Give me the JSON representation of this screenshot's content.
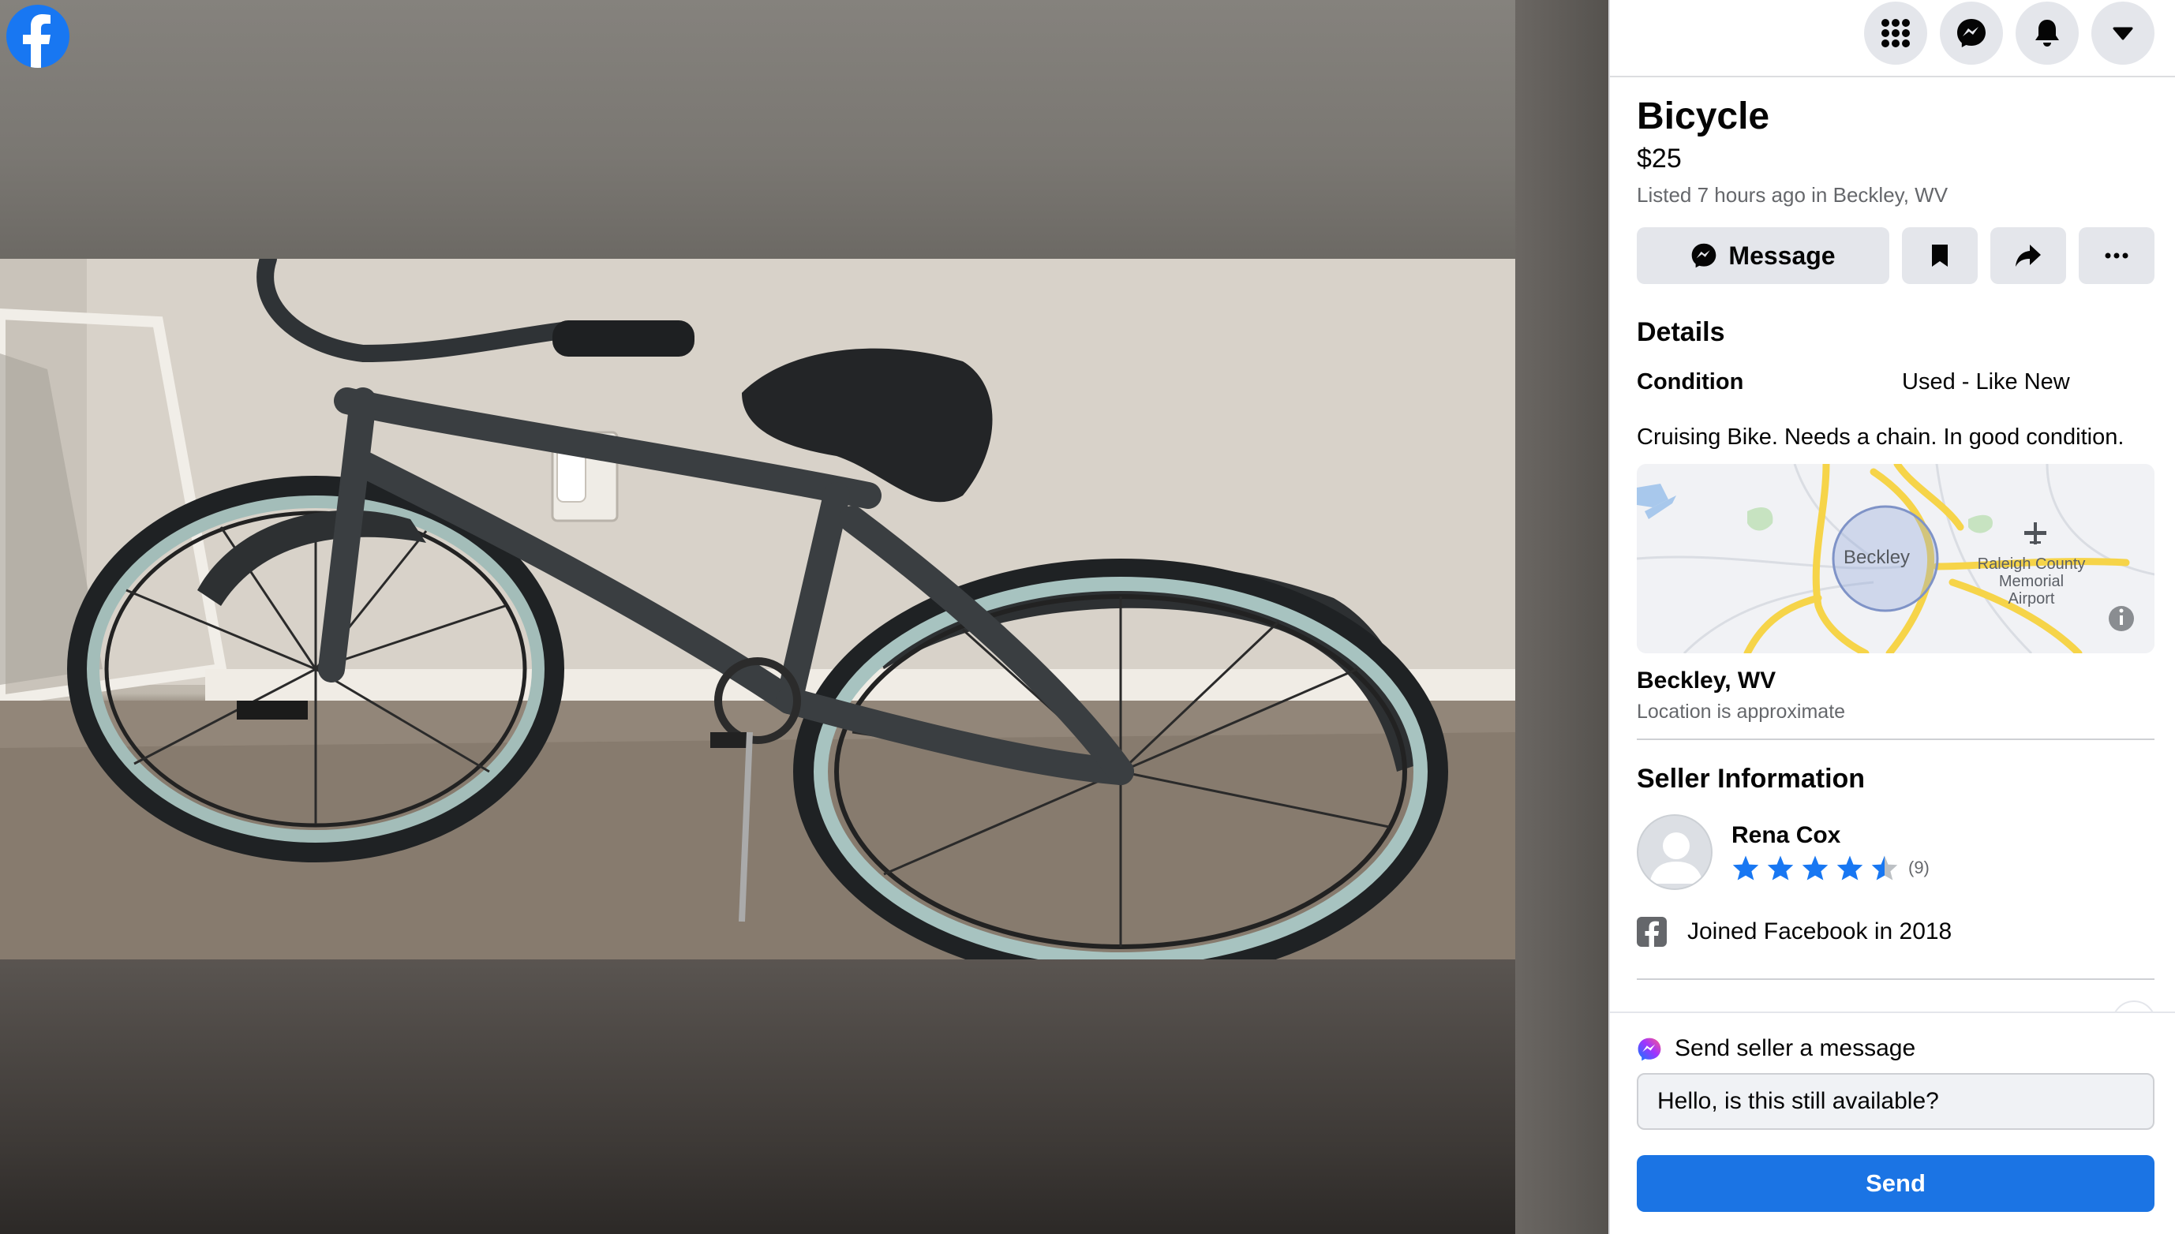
{
  "header": {
    "logo_icon": "facebook-logo-icon",
    "buttons": [
      {
        "name": "menu",
        "icon": "grid-menu-icon"
      },
      {
        "name": "messenger",
        "icon": "messenger-icon"
      },
      {
        "name": "notifications",
        "icon": "bell-icon"
      },
      {
        "name": "account",
        "icon": "caret-down-icon"
      }
    ]
  },
  "listing": {
    "title": "Bicycle",
    "price": "$25",
    "meta": "Listed 7 hours ago in Beckley, WV",
    "photo_icon": "bicycle-photo"
  },
  "actions": {
    "message_label": "Message",
    "message_icon": "messenger-icon",
    "save_icon": "bookmark-icon",
    "share_icon": "share-arrow-icon",
    "more_icon": "ellipsis-icon"
  },
  "details": {
    "heading": "Details",
    "condition_label": "Condition",
    "condition_value": "Used - Like New",
    "description": "Cruising Bike. Needs a chain. In good condition."
  },
  "map": {
    "city_label": "Beckley",
    "airport_label": "Raleigh County Memorial Airport",
    "location_name": "Beckley, WV",
    "location_note": "Location is approximate"
  },
  "seller": {
    "heading": "Seller Information",
    "name": "Rena Cox",
    "rating": 4.5,
    "rating_max": 5,
    "rating_count": "(9)",
    "joined": "Joined Facebook in 2018"
  },
  "message_box": {
    "heading": "Send seller a message",
    "input_value": "Hello, is this still available?",
    "send_label": "Send"
  },
  "colors": {
    "brand_blue": "#1877f2",
    "button_gray": "#e4e6eb",
    "secondary_text": "#65676b",
    "send_button": "#1b74e4",
    "map_road": "#f6d449"
  }
}
